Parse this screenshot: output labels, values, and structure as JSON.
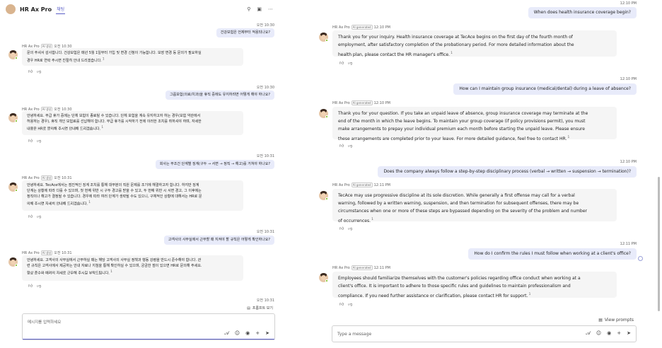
{
  "app": {
    "name": "HR Ax Pro",
    "tab": "채팅"
  },
  "left": {
    "messages": [
      {
        "time": "오전 10:30",
        "text": "건강보험은 언제부터 적용되나요?"
      },
      {
        "meta": "HR Ax Pro",
        "aig": "AI 생성",
        "time": "오전 10:30",
        "lines": [
          "문의 주셔서 감사합니다. 건강보험은 매년 5월 1일부터 가입 및 변경 신청이 가능합니다. 보장 변경 등 문의가 필요하실",
          "경우 HR로 연락 주시면 친절히 안내 드리겠습니다."
        ],
        "ref": "1"
      },
      {
        "time": "오전 10:30",
        "text": "그룹보험(의료/치과)을 휴직 중에도 유지하려면 어떻게 해야 하나요?"
      },
      {
        "meta": "HR Ax Pro",
        "aig": "AI 생성",
        "time": "오전 10:30",
        "lines": [
          "안녕하세요. 무급 휴가 중에는 단체 보험이 종료될 수 있습니다. 단체 보험을 계속 유지하고자 하는 경우(보험 약관에서",
          "허용하는 경우), 휴직 개인 보험료를 선납해야 합니다. 무급 휴가를 시작하기 전에 이러한 조치를 취하셔야 하며, 자세한",
          "내용은 HR로 문의해 주시면 안내해 드리겠습니다."
        ],
        "ref": "1"
      },
      {
        "time": "오전 10:31",
        "text": "회사는 무조건 단계별 징계(구두 → 서면 → 정직 → 해고)를 거쳐야 하나요?"
      },
      {
        "meta": "HR Ax Pro",
        "aig": "AI 생성",
        "time": "오전 10:31",
        "lines": [
          "안녕하세요. TecAce에서는 점진적인 징계 조치를 통해 대부분의 직원 문제를 조기에 해결하고자 합니다. 하지만 징계",
          "단계는 상황에 따라 다를 수 있으며, 첫 번째 위반 시 구두 경고를 받을 수 있고, 두 번째 위반 시 서면 경고, 그 이후에는",
          "정직이나 해고가 결정될 수 있습니다. 경우에 따라 여러 단계가 생략될 수도 있으니, 구체적인 상황에 대해서는 HR로 문",
          "의해 주시면 자세히 안내해 드리겠습니다."
        ],
        "ref": "1"
      },
      {
        "time": "오전 10:31",
        "text": "고객사의 사무실에서 근무할 때 지켜야 할 규칙은 어떻게 확인하나요?"
      },
      {
        "meta": "HR Ax Pro",
        "aig": "AI 생성",
        "time": "오전 10:31",
        "lines": [
          "안녕하세요. 고객사의 사무실에서 근무하실 때는 해당 고객사의 사무실 정책과 행동 강령을 반드시 준수해야 합니다. 관",
          "련 규칙은 고객사에서 제공하는 안내 자료나 지침을 통해 확인하실 수 있으며, 궁금한 점이 있으면 HR로 문의해 주세요.",
          "항상 준수와 배려의 자세로 근무해 주시길 부탁드립니다."
        ],
        "ref": "1"
      }
    ],
    "last_time": "오전 10:31",
    "view_prompts": "프롬프트 보기",
    "compose_placeholder": "메시지를 입력하세요"
  },
  "right": {
    "messages": [
      {
        "time": "12:10 PM",
        "text": "When does health insurance coverage begin?"
      },
      {
        "meta": "HR Ax Pro",
        "aig": "AI generated",
        "time": "12:10 PM",
        "lines": [
          "Thank you for your inquiry. Health insurance coverage at TecAce begins on the first day of the fourth month of",
          "employment, after satisfactory completion of the probationary period. For more detailed information about the",
          "health plan, please contact the HR manager's office."
        ],
        "ref": "1"
      },
      {
        "time": "12:10 PM",
        "text": "How can I maintain group insurance (medical/dental) during a leave of absence?"
      },
      {
        "meta": "HR Ax Pro",
        "aig": "AI generated",
        "time": "12:10 PM",
        "lines": [
          "Thank you for your question. If you take an unpaid leave of absence, group insurance coverage may terminate at the",
          "end of the month in which the leave begins. To maintain your group coverage (if policy provisions permit), you must",
          "make arrangements to prepay your individual premium each month before starting the unpaid leave. Please ensure",
          "these arrangements are completed prior to your leave. For more detailed guidance, feel free to contact HR."
        ],
        "ref": "1"
      },
      {
        "time": "12:10 PM",
        "text": "Does the company always follow a step-by-step disciplinary process (verbal → written → suspension → termination)?"
      },
      {
        "meta": "HR Ax Pro",
        "aig": "AI generated",
        "time": "12:11 PM",
        "lines": [
          "TecAce may use progressive discipline at its sole discretion. While generally a first offense may call for a verbal",
          "warning, followed by a written warning, suspension, and then termination for subsequent offenses, there may be",
          "circumstances when one or more of these steps are bypassed depending on the severity of the problem and number",
          "of occurrences."
        ],
        "ref": "1"
      },
      {
        "time": "12:11 PM",
        "text": "How do I confirm the rules I must follow when working at a client's office?"
      },
      {
        "meta": "HR Ax Pro",
        "aig": "AI generated",
        "time": "12:11 PM",
        "lines": [
          "Employees should familiarize themselves with the customer's policies regarding office conduct when working at a",
          "client's office. It is important to adhere to those specific rules and guidelines to maintain professionalism and",
          "compliance. If you need further assistance or clarification, please contact HR for support."
        ],
        "ref": "1"
      }
    ],
    "view_prompts": "View prompts",
    "compose_placeholder": "Type a message"
  },
  "colors": {
    "accent": "#5b5fc7",
    "user_bubble": "#e8ebfa",
    "bot_bubble": "#f5f5f5",
    "presence": "#6bb700"
  }
}
